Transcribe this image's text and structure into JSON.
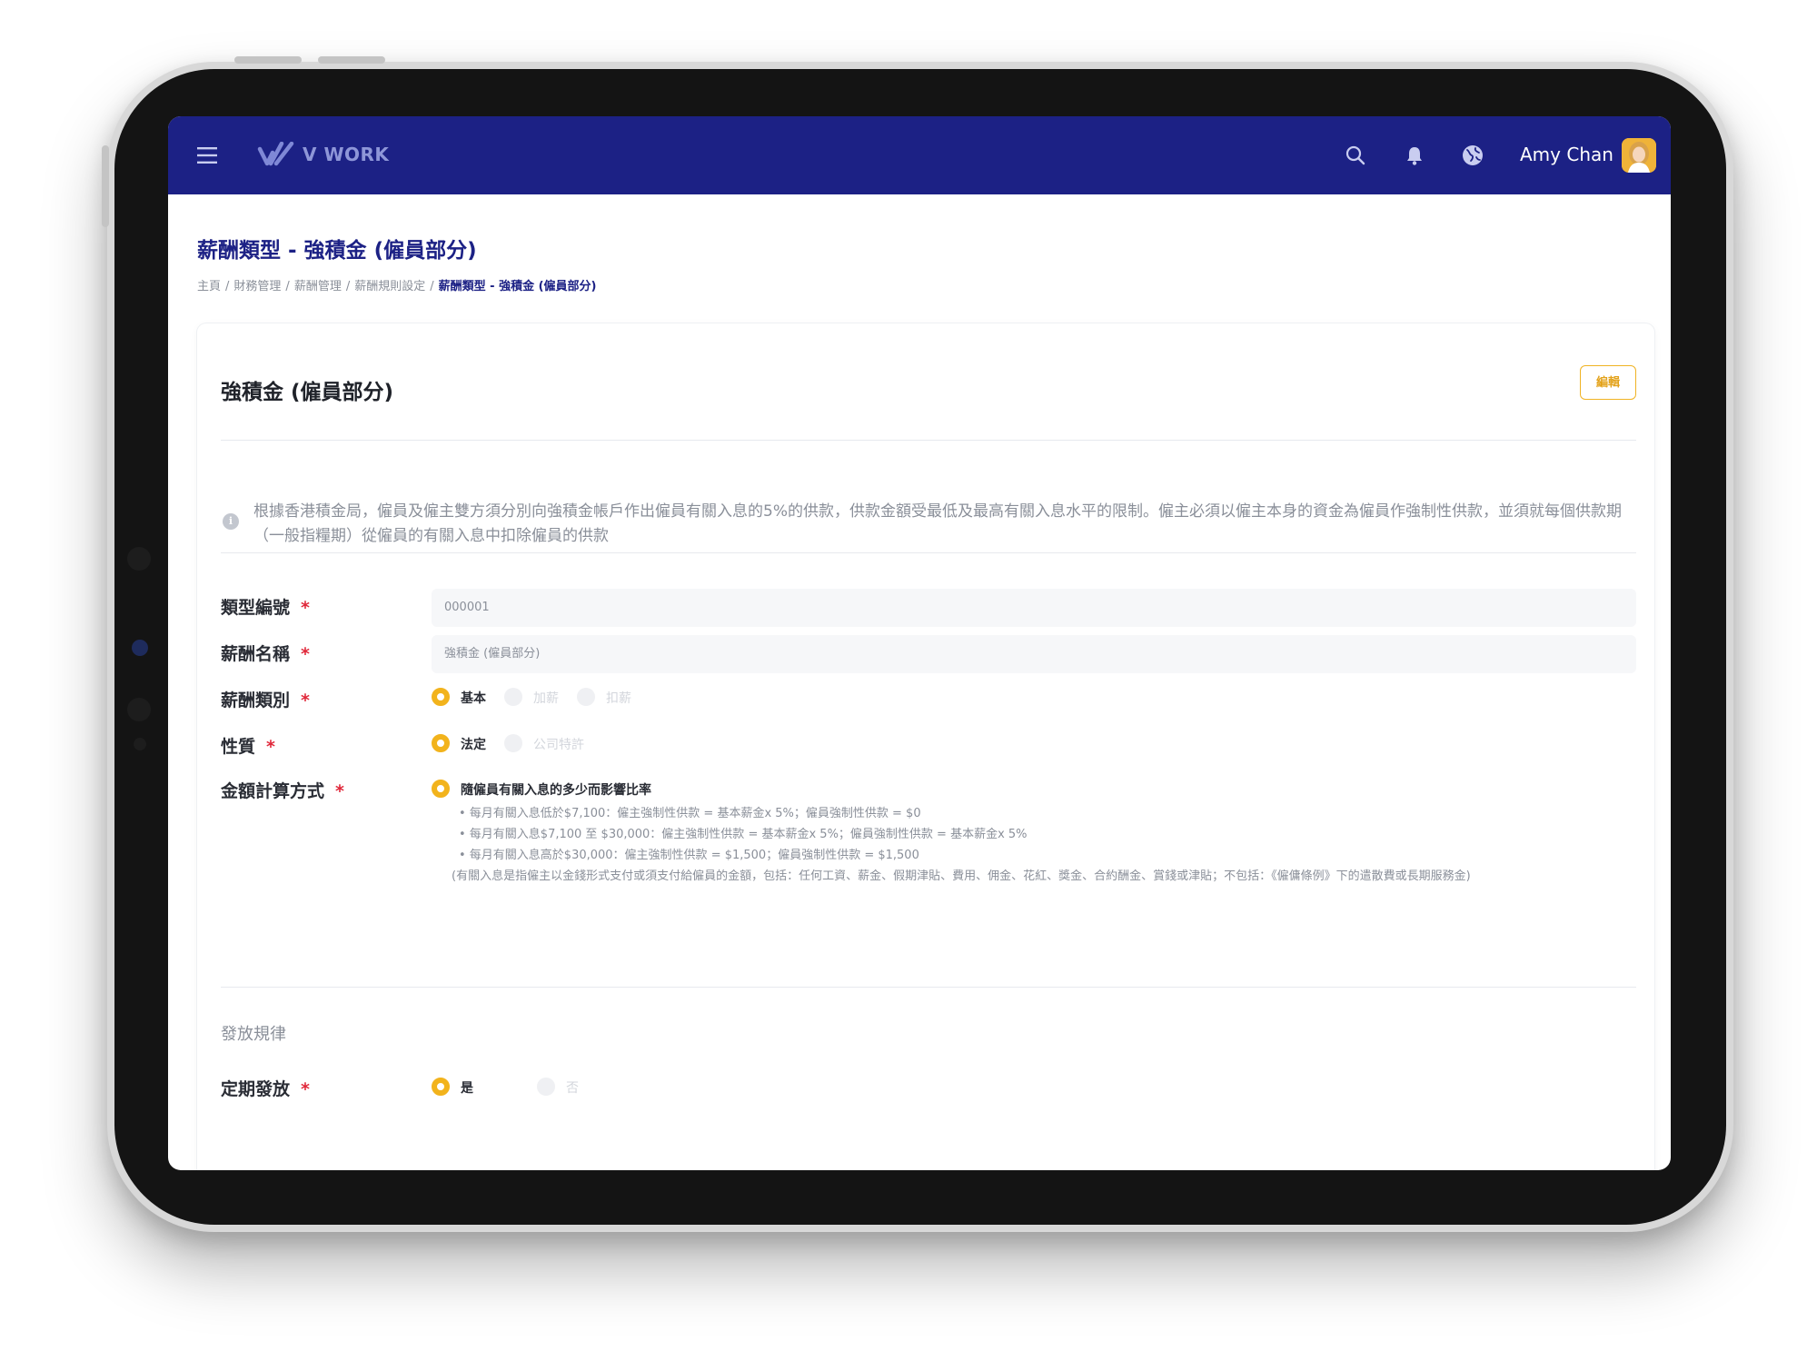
{
  "app": {
    "brand": "V WORK",
    "user_name": "Amy Chan"
  },
  "page": {
    "title": "薪酬類型 - 強積金 (僱員部分)",
    "breadcrumb": [
      "主頁",
      "財務管理",
      "薪酬管理",
      "薪酬規則設定",
      "薪酬類型 - 強積金 (僱員部分)"
    ]
  },
  "card": {
    "title": "強積金 (僱員部分)",
    "edit_label": "編輯",
    "info": "根據香港積金局，僱員及僱主雙方須分別向強積金帳戶作出僱員有關入息的5%的供款，供款金額受最低及最高有關入息水平的限制。僱主必須以僱主本身的資金為僱員作強制性供款，並須就每個供款期（一般指糧期）從僱員的有關入息中扣除僱員的供款"
  },
  "form": {
    "type_code": {
      "label": "類型編號",
      "value": "000001"
    },
    "salary_name": {
      "label": "薪酬名稱",
      "value": "強積金 (僱員部分)"
    },
    "salary_category": {
      "label": "薪酬類別",
      "options": [
        "基本",
        "加薪",
        "扣薪"
      ],
      "selected": "基本"
    },
    "nature": {
      "label": "性質",
      "options": [
        "法定",
        "公司特許"
      ],
      "selected": "法定"
    },
    "calc_method": {
      "label": "金額計算方式",
      "option": "隨僱員有關入息的多少而影響比率",
      "notes": [
        "•  每月有關入息低於$7,100：僱主強制性供款 = 基本薪金x 5%；僱員強制性供款 = $0",
        "•  每月有關入息$7,100 至 $30,000：僱主強制性供款 = 基本薪金x 5%；僱員強制性供款 = 基本薪金x 5%",
        "•  每月有關入息高於$30,000：僱主強制性供款 = $1,500；僱員強制性供款 = $1,500",
        "(有關入息是指僱主以金錢形式支付或須支付給僱員的金額，包括：任何工資、薪金、假期津貼、費用、佣金、花紅、獎金、合約酬金、賞錢或津貼；不包括：《僱傭條例》下的遣散費或長期服務金)"
      ]
    },
    "section_title": "發放規律",
    "regular_payment": {
      "label": "定期發放",
      "options": [
        "是",
        "否"
      ],
      "selected": "是"
    }
  },
  "colors": {
    "navbar": "#1c2185",
    "accent": "#f2b31c",
    "required": "#e0283a"
  }
}
